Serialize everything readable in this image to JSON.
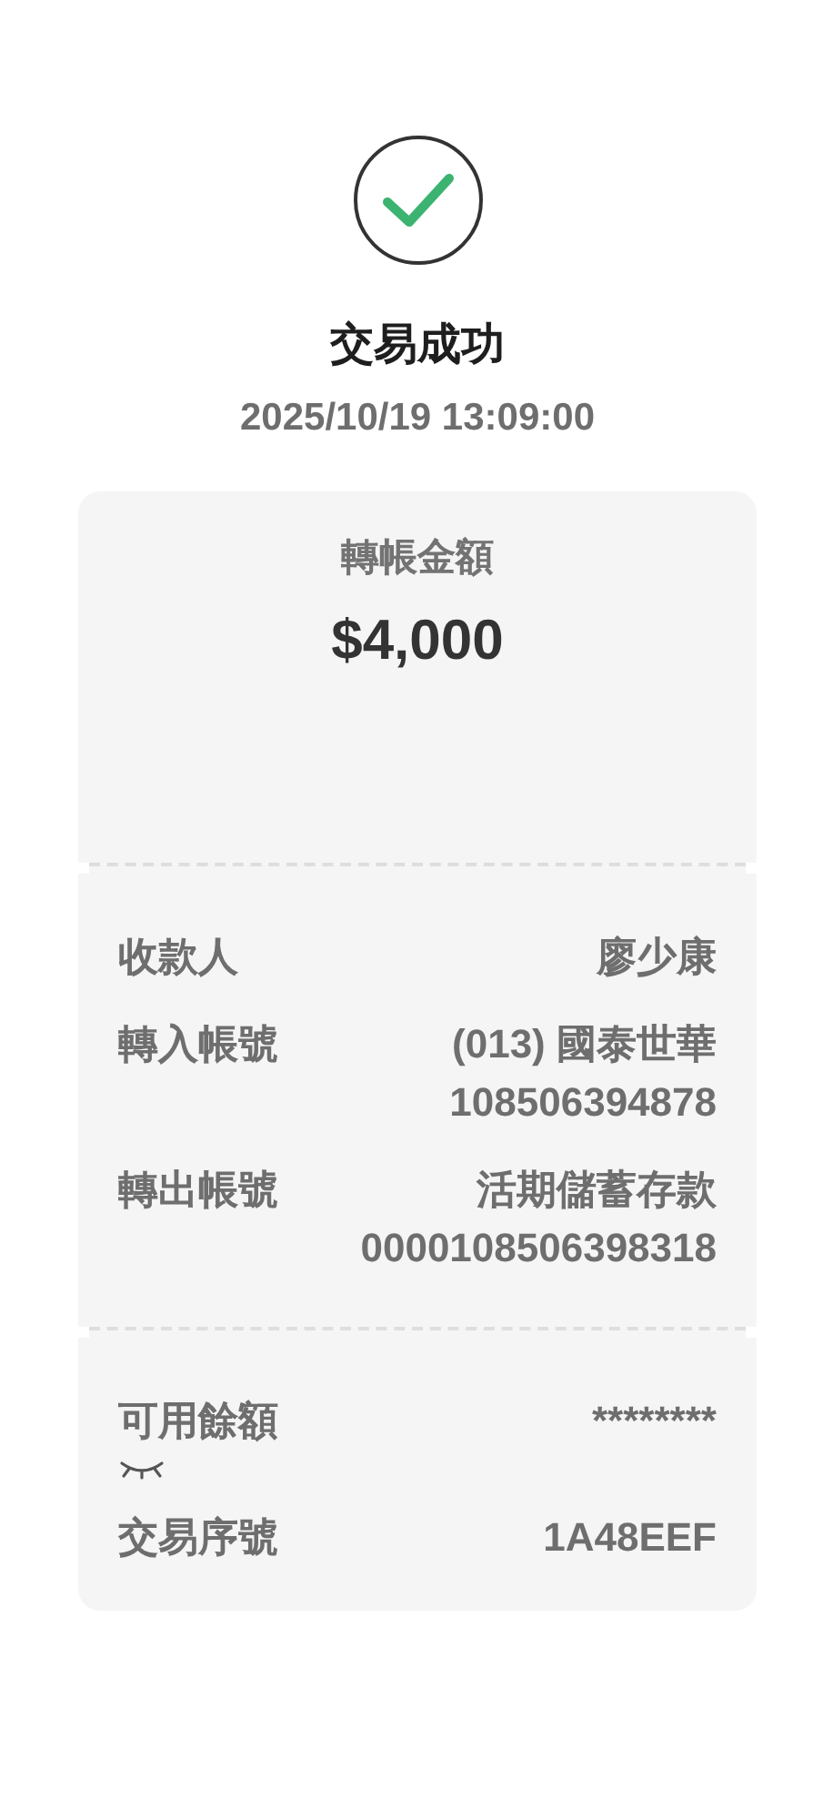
{
  "status": {
    "title": "交易成功",
    "datetime": "2025/10/19 13:09:00"
  },
  "amount": {
    "label": "轉帳金額",
    "value": "$4,000"
  },
  "details": [
    {
      "label": "收款人",
      "values": [
        "廖少康"
      ]
    },
    {
      "label": "轉入帳號",
      "values": [
        "(013) 國泰世華",
        "108506394878"
      ]
    },
    {
      "label": "轉出帳號",
      "values": [
        "活期儲蓄存款",
        "0000108506398318"
      ]
    }
  ],
  "extra": [
    {
      "label": "可用餘額",
      "value": "********",
      "kind": "masked"
    },
    {
      "label": "交易序號",
      "value": "1A48EEF",
      "kind": "plain"
    }
  ]
}
